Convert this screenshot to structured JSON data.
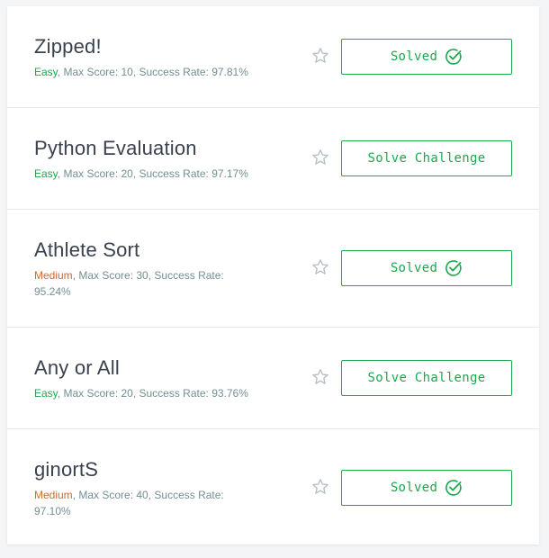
{
  "challenges": [
    {
      "title": "Zipped!",
      "difficulty": "Easy",
      "details": ", Max Score: 10, Success Rate: 97.81%",
      "action": "Solved",
      "solved": true
    },
    {
      "title": "Python Evaluation",
      "difficulty": "Easy",
      "details": ", Max Score: 20, Success Rate: 97.17%",
      "action": "Solve Challenge",
      "solved": false
    },
    {
      "title": "Athlete Sort",
      "difficulty": "Medium",
      "details": ", Max Score: 30, Success Rate: 95.24%",
      "action": "Solved",
      "solved": true
    },
    {
      "title": "Any or All",
      "difficulty": "Easy",
      "details": ", Max Score: 20, Success Rate: 93.76%",
      "action": "Solve Challenge",
      "solved": false
    },
    {
      "title": "ginortS",
      "difficulty": "Medium",
      "details": ", Max Score: 40, Success Rate: 97.10%",
      "action": "Solved",
      "solved": true
    }
  ],
  "colors": {
    "easy": "#1ba94c",
    "medium": "#d3692d",
    "accent": "#1ba94c",
    "title": "#39424e",
    "meta": "#738f93"
  },
  "icons": {
    "bookmark": "star-outline-icon",
    "solved": "check-circle-icon"
  }
}
